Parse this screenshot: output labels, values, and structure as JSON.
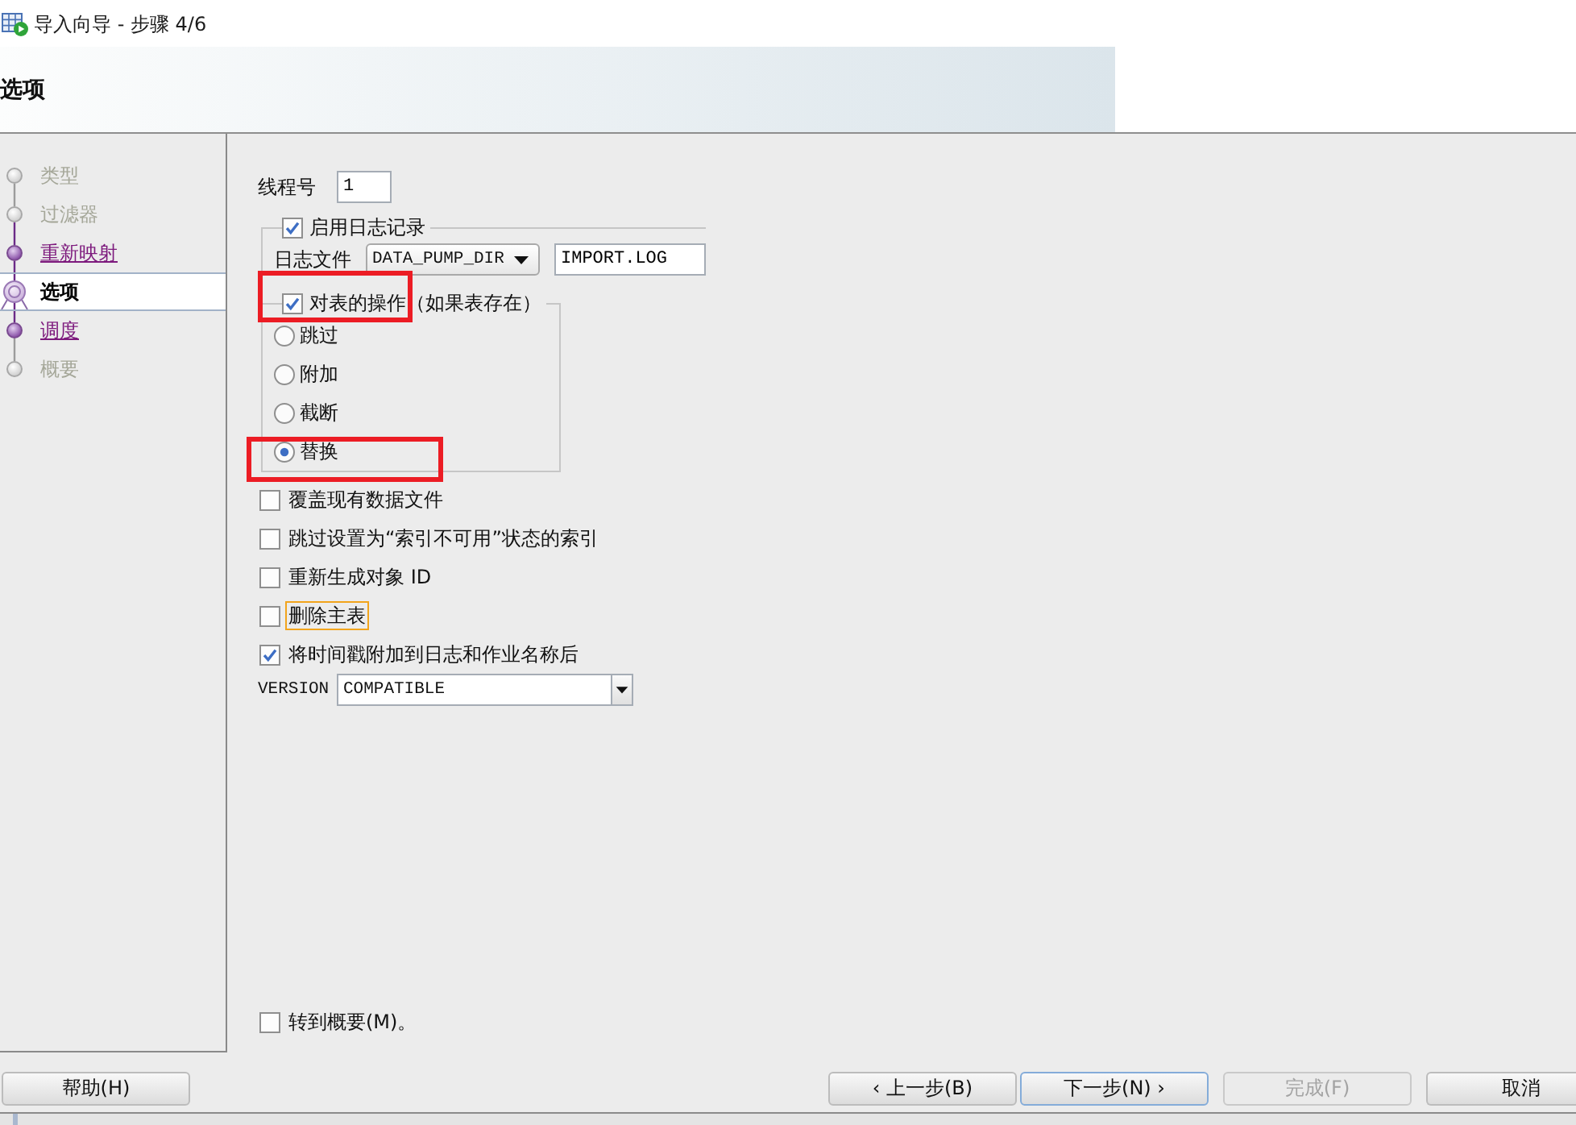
{
  "window": {
    "title": "导入向导 - 步骤 4/6"
  },
  "header": {
    "title": "选项"
  },
  "steps": [
    {
      "label": "类型",
      "selected": false,
      "visited": false
    },
    {
      "label": "过滤器",
      "selected": false,
      "visited": false
    },
    {
      "label": "重新映射",
      "selected": false,
      "visited": true
    },
    {
      "label": "选项",
      "selected": true,
      "visited": true
    },
    {
      "label": "调度",
      "selected": false,
      "visited": true
    },
    {
      "label": "概要",
      "selected": false,
      "visited": false
    }
  ],
  "thread_count": {
    "label": "线程号",
    "value": "1"
  },
  "logging": {
    "label": "启用日志记录",
    "checked": true,
    "file_label": "日志文件",
    "directory": "DATA_PUMP_DIR",
    "file_name": "IMPORT.LOG"
  },
  "table_action": {
    "label": "对表的操作（如果表存在）",
    "checked": true,
    "highlighted": true,
    "options": [
      {
        "label": "跳过",
        "selected": false,
        "highlighted": false
      },
      {
        "label": "附加",
        "selected": false,
        "highlighted": false
      },
      {
        "label": "截断",
        "selected": false,
        "highlighted": false
      },
      {
        "label": "替换",
        "selected": true,
        "highlighted": true
      }
    ]
  },
  "options": [
    {
      "label": "覆盖现有数据文件",
      "checked": false,
      "focused": false
    },
    {
      "label": "跳过设置为“索引不可用”状态的索引",
      "checked": false,
      "focused": false
    },
    {
      "label": "重新生成对象 ID",
      "checked": false,
      "focused": false
    },
    {
      "label": "删除主表",
      "checked": false,
      "focused": true
    },
    {
      "label": "将时间戳附加到日志和作业名称后",
      "checked": true,
      "focused": false
    }
  ],
  "version": {
    "label": "VERSION",
    "value": "COMPATIBLE"
  },
  "go_to_summary": {
    "label": "转到概要(M)。",
    "checked": false
  },
  "buttons": [
    {
      "label": "帮助(H)",
      "kind": "help",
      "disabled": false,
      "focused": false
    },
    {
      "label": "‹ 上一步(B)",
      "kind": "back",
      "disabled": false,
      "focused": false
    },
    {
      "label": "下一步(N) ›",
      "kind": "next",
      "disabled": false,
      "focused": true
    },
    {
      "label": "完成(F)",
      "kind": "finish",
      "disabled": true,
      "focused": false
    },
    {
      "label": "取消",
      "kind": "cancel",
      "disabled": false,
      "focused": false
    }
  ]
}
